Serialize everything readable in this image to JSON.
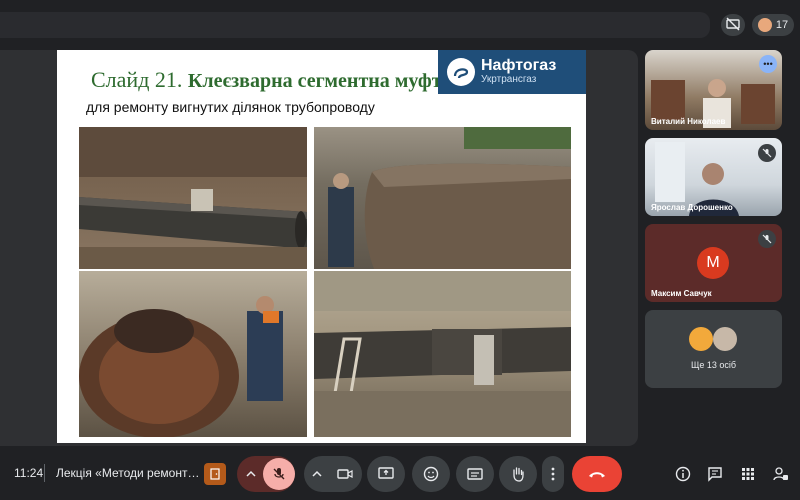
{
  "topbar": {
    "participant_count": "17"
  },
  "slide": {
    "title_prefix": "Слайд 21.",
    "title_main": "Клеєзварна сегментна муфта.",
    "subtitle": "для ремонту вигнутих  ділянок трубопроводу",
    "logo_name": "Нафтогаз",
    "logo_sub": "Укртрансгаз"
  },
  "participants": [
    {
      "name": "Виталий Николаев",
      "more_label": "•••"
    },
    {
      "name": "Ярослав Дорошенко"
    },
    {
      "name": "Максим Савчук",
      "initial": "М"
    }
  ],
  "others": {
    "label": "Ще 13 осіб"
  },
  "bottom": {
    "time": "11:24",
    "meeting_title": "Лекція «Методи ремонт…"
  }
}
